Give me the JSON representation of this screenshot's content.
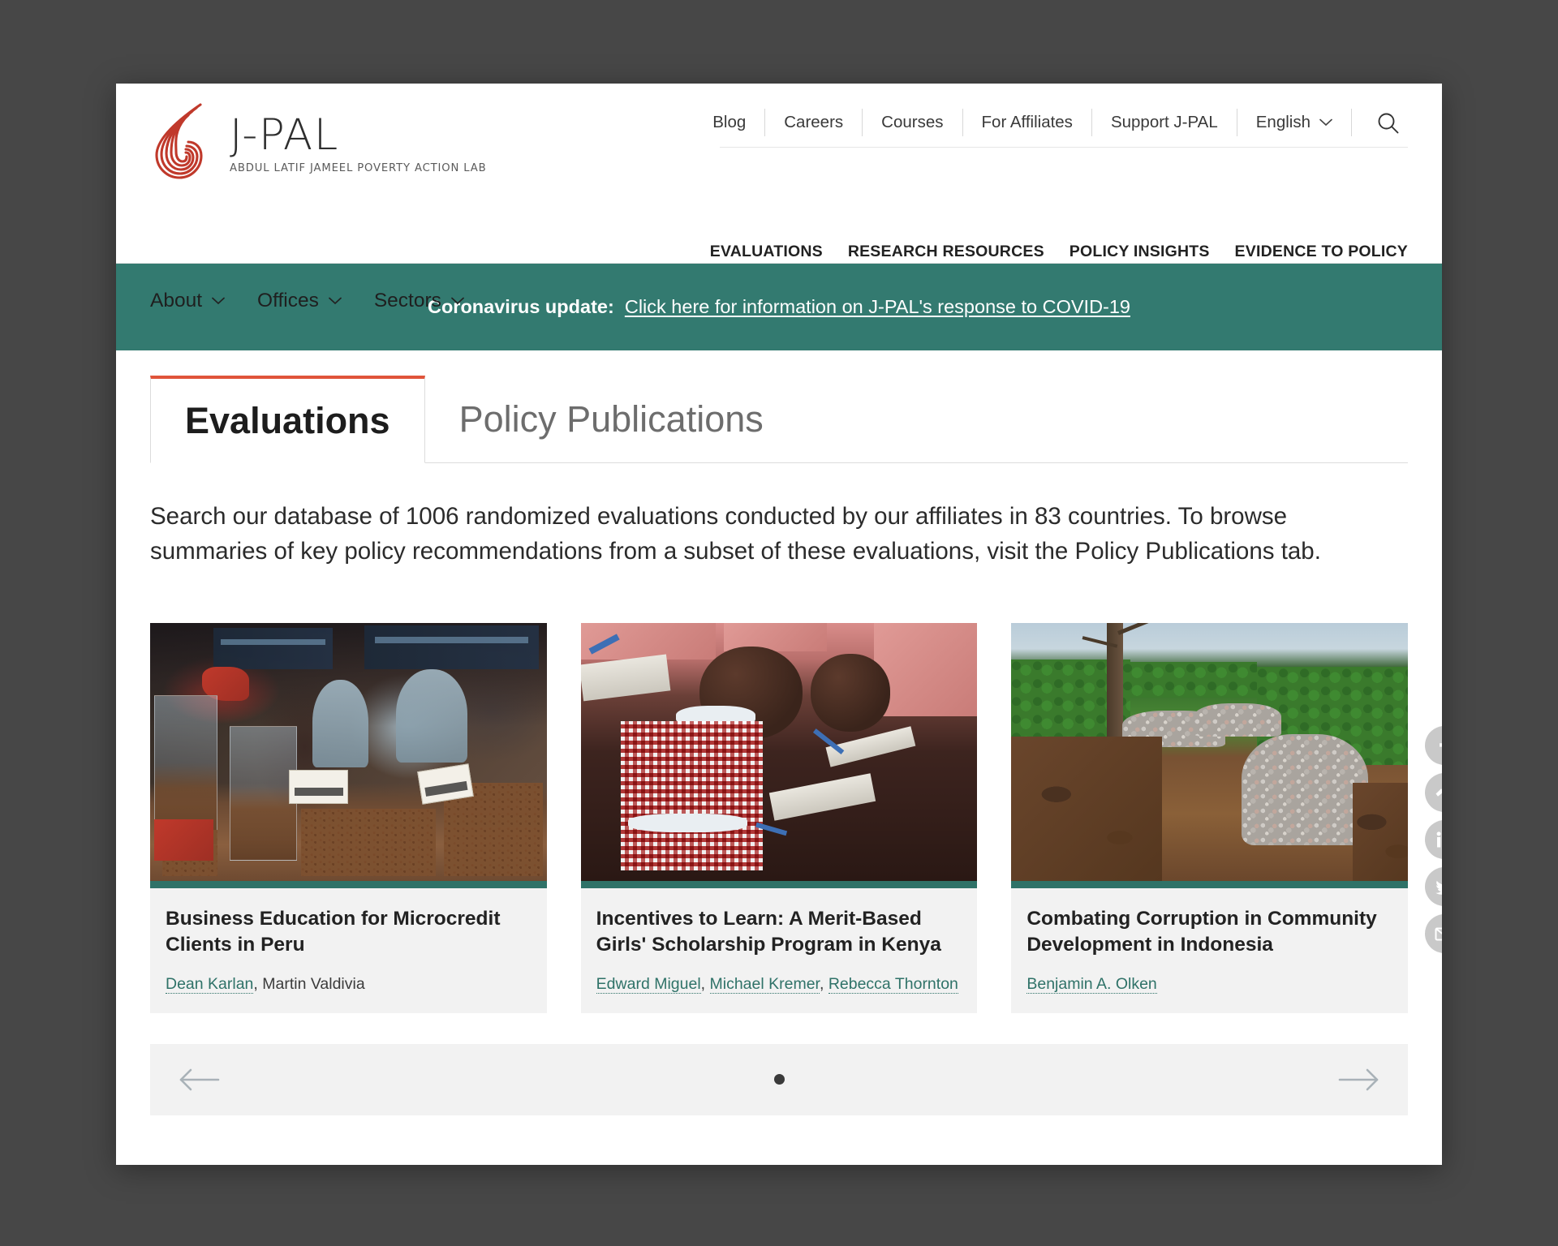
{
  "site": {
    "logo_title": "J-PAL",
    "logo_subtitle": "ABDUL LATIF JAMEEL POVERTY ACTION LAB"
  },
  "utility_nav": {
    "items": [
      {
        "label": "Blog"
      },
      {
        "label": "Careers"
      },
      {
        "label": "Courses"
      },
      {
        "label": "For Affiliates"
      },
      {
        "label": "Support J-PAL"
      }
    ],
    "language": "English",
    "search_icon": "search-icon"
  },
  "main_nav": {
    "items": [
      {
        "label": "EVALUATIONS"
      },
      {
        "label": "RESEARCH RESOURCES"
      },
      {
        "label": "POLICY INSIGHTS"
      },
      {
        "label": "EVIDENCE TO POLICY"
      }
    ]
  },
  "sub_nav": {
    "items": [
      {
        "label": "About"
      },
      {
        "label": "Offices"
      },
      {
        "label": "Sectors"
      }
    ]
  },
  "banner": {
    "prefix": "Coronavirus update:",
    "link_text": "Click here for information on J-PAL's response to COVID-19",
    "background_color": "#337a70"
  },
  "tabs": [
    {
      "label": "Evaluations",
      "active": true
    },
    {
      "label": "Policy Publications",
      "active": false
    }
  ],
  "intro": {
    "text": "Search our database of 1006 randomized evaluations conducted by our affiliates in 83 countries. To browse summaries of key policy recommendations from a subset of these evaluations, visit the Policy Publications tab.",
    "evaluation_count": "1006",
    "country_count": "83"
  },
  "social": {
    "items": [
      {
        "name": "facebook-icon"
      },
      {
        "name": "messenger-icon"
      },
      {
        "name": "linkedin-icon"
      },
      {
        "name": "twitter-icon"
      },
      {
        "name": "email-icon"
      }
    ]
  },
  "cards": [
    {
      "title": "Business Education for Microcredit Clients in Peru",
      "authors": [
        {
          "name": "Dean Karlan",
          "link": true
        },
        {
          "name": "Martin Valdivia",
          "link": false
        }
      ],
      "image_alt": "market-stall-grain-bins",
      "accent_color": "#2f7268"
    },
    {
      "title": "Incentives to Learn: A Merit-Based Girls' Scholarship Program in Kenya",
      "authors": [
        {
          "name": "Edward Miguel",
          "link": true
        },
        {
          "name": "Michael Kremer",
          "link": true
        },
        {
          "name": "Rebecca Thornton",
          "link": true
        }
      ],
      "image_alt": "students-writing-in-classroom",
      "accent_color": "#2f7268"
    },
    {
      "title": "Combating Corruption in Community Development in Indonesia",
      "authors": [
        {
          "name": "Benjamin A. Olken",
          "link": true
        }
      ],
      "image_alt": "rural-road-construction-gravel",
      "accent_color": "#2f7268"
    }
  ],
  "carousel": {
    "prev_label": "Previous",
    "next_label": "Next",
    "dots": [
      {
        "active": true
      }
    ],
    "current_page": 1,
    "total_pages": 1
  },
  "colors": {
    "teal": "#337a70",
    "card_accent": "#2f7268",
    "tab_accent": "#e0543a",
    "logo_red": "#c0392b",
    "backdrop": "#474747"
  }
}
